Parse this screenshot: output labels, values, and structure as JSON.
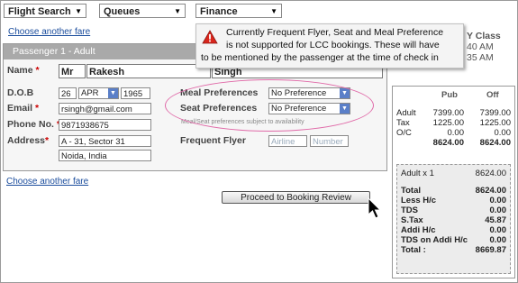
{
  "menu": {
    "flight_search": "Flight Search",
    "queues": "Queues",
    "finance": "Finance"
  },
  "links": {
    "choose_fare_top": "Choose another fare",
    "choose_fare_bottom": "Choose another fare"
  },
  "tooltip": {
    "line1": "Currently Frequent Flyer, Seat and Meal Preference",
    "line2": "is not supported for LCC bookings. These will have",
    "line3": "to be mentioned by the passenger at the time of check in"
  },
  "behind_tooltip": {
    "class_label": "Y Class",
    "time1": "40 AM",
    "time2": "35 AM"
  },
  "passenger": {
    "header": "Passenger 1 - Adult",
    "name_label": "Name",
    "title": "Mr",
    "first_name": "Rakesh",
    "last_name": "Singh",
    "dob_label": "D.O.B",
    "dob_day": "26",
    "dob_month": "APR",
    "dob_year": "1965",
    "email_label": "Email",
    "email": "rsingh@gmail.com",
    "phone_label": "Phone No.",
    "phone": "9871938675",
    "address_label": "Address",
    "address1": "A - 31, Sector 31",
    "address2": "Noida, India",
    "req_marker": "*"
  },
  "preferences": {
    "meal_label": "Meal Preferences",
    "meal_value": "No Preference",
    "seat_label": "Seat Preferences",
    "seat_value": "No Preference",
    "note": "Meal/Seat preferences subject to availability",
    "ff_label": "Frequent Flyer",
    "airline_placeholder": "Airline",
    "number_placeholder": "Number"
  },
  "fare": {
    "col1": "Pub",
    "col2": "Off",
    "rows": [
      {
        "label": "Adult",
        "pub": "7399.00",
        "off": "7399.00"
      },
      {
        "label": "Tax",
        "pub": "1225.00",
        "off": "1225.00"
      },
      {
        "label": "O/C",
        "pub": "0.00",
        "off": "0.00"
      }
    ],
    "subtotal_pub": "8624.00",
    "subtotal_off": "8624.00",
    "summary": [
      {
        "label": "Adult x 1",
        "value": "8624.00",
        "bold": false
      },
      {
        "label": "Total",
        "value": "8624.00",
        "bold": true
      },
      {
        "label": "Less H/c",
        "value": "0.00",
        "bold": true
      },
      {
        "label": "TDS",
        "value": "0.00",
        "bold": true
      },
      {
        "label": "S.Tax",
        "value": "45.87",
        "bold": true
      },
      {
        "label": "Addi H/c",
        "value": "0.00",
        "bold": true
      },
      {
        "label": "TDS on Addi H/c",
        "value": "0.00",
        "bold": true
      },
      {
        "label": "Total :",
        "value": "8669.87",
        "bold": true
      }
    ]
  },
  "actions": {
    "proceed": "Proceed to Booking Review"
  },
  "colors": {
    "header_gray": "#a9a9a9",
    "link_blue": "#1a4c9c",
    "ellipse_pink": "#e06aa8",
    "required_red": "#cc0000",
    "warning_red": "#d9261c"
  },
  "icons": {
    "warning": "warning-icon",
    "dropdown": "chevron-down-icon",
    "cursor": "mouse-pointer-icon"
  }
}
